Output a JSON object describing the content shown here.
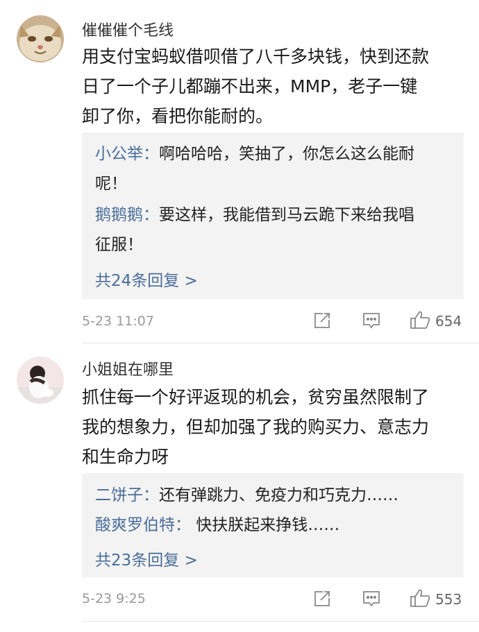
{
  "comments": [
    {
      "username": "催催催个毛线",
      "avatar_icon": "cat-avatar-icon",
      "lines": [
        "用支付宝蚂蚁借呗借了八千多块钱，快到还款",
        "日了一个子儿都蹦不出来，MMP，老子一键",
        "卸了你，看把你能耐的。"
      ],
      "replies": [
        {
          "who": "小公举：",
          "text": "啊哈哈哈，笑抽了，你怎么这么能耐",
          "cont": "呢！"
        },
        {
          "who": "鹅鹅鹅：",
          "text": "要这样，我能借到马云跪下来给我唱",
          "cont": "征服！"
        }
      ],
      "more_replies": "共24条回复 >",
      "time": "5-23  11:07",
      "likes": "654"
    },
    {
      "username": "小姐姐在哪里",
      "avatar_icon": "girl-avatar-icon",
      "lines": [
        "抓住每一个好评返现的机会，贫穷虽然限制了",
        "我的想象力，但却加强了我的购买力、意志力",
        "和生命力呀"
      ],
      "replies": [
        {
          "who": "二饼子：",
          "text": "还有弹跳力、免疫力和巧克力……"
        },
        {
          "who": "酸爽罗伯特：",
          "text": " 快扶朕起来挣钱……"
        }
      ],
      "more_replies": "共23条回复 >",
      "time": "5-23  9:25",
      "likes": "553"
    }
  ],
  "icons": {
    "share": "share-icon",
    "comment": "comment-icon",
    "like": "thumbs-up-icon"
  },
  "colors": {
    "link": "#4a6e9a",
    "meta": "#999999",
    "reply_bg": "#f3f3f3"
  }
}
